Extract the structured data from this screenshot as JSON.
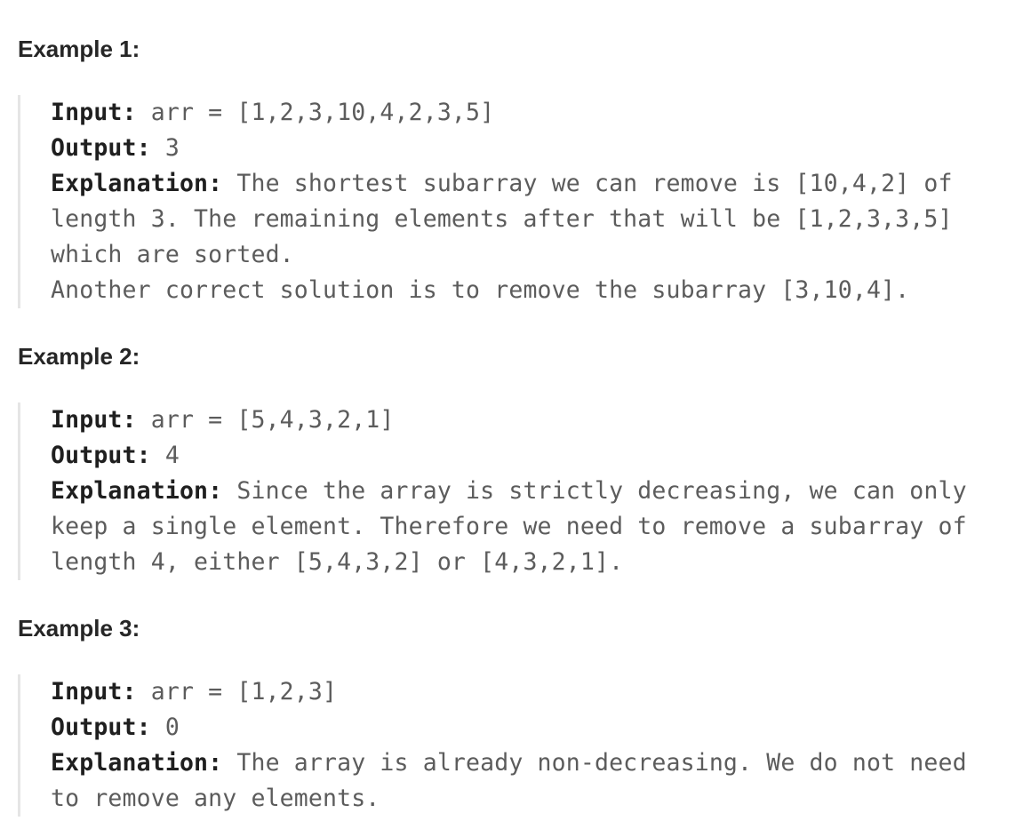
{
  "examples": [
    {
      "heading": "Example 1:",
      "input_label": "Input:",
      "input_value": " arr = [1,2,3,10,4,2,3,5]",
      "output_label": "Output:",
      "output_value": " 3",
      "explanation_label": "Explanation:",
      "explanation_lines": [
        " The shortest subarray we can remove is [10,4,2] of",
        "length 3. The remaining elements after that will be [1,2,3,3,5]",
        "which are sorted.",
        "Another correct solution is to remove the subarray [3,10,4]."
      ]
    },
    {
      "heading": "Example 2:",
      "input_label": "Input:",
      "input_value": " arr = [5,4,3,2,1]",
      "output_label": "Output:",
      "output_value": " 4",
      "explanation_label": "Explanation:",
      "explanation_lines": [
        " Since the array is strictly decreasing, we can only",
        "keep a single element. Therefore we need to remove a subarray of",
        "length 4, either [5,4,3,2] or [4,3,2,1]."
      ]
    },
    {
      "heading": "Example 3:",
      "input_label": "Input:",
      "input_value": " arr = [1,2,3]",
      "output_label": "Output:",
      "output_value": " 0",
      "explanation_label": "Explanation:",
      "explanation_lines": [
        " The array is already non-decreasing. We do not need",
        "to remove any elements."
      ]
    }
  ]
}
